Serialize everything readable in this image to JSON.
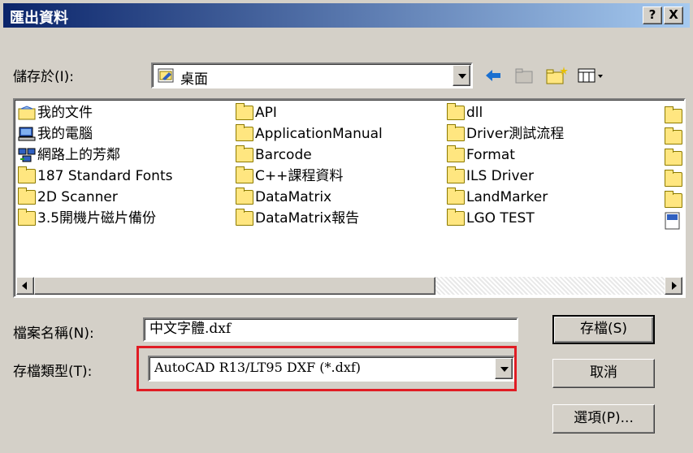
{
  "title": "匯出資料",
  "title_buttons": {
    "help": "?",
    "close": "X"
  },
  "save_in": {
    "label": "儲存於",
    "accel": "(I):",
    "value": "桌面"
  },
  "icons": [
    "back-arrow-icon",
    "up-folder-icon",
    "new-folder-icon",
    "view-menu-icon"
  ],
  "files": {
    "col1": [
      "我的文件",
      "我的電腦",
      "網路上的芳鄰",
      "187 Standard  Fonts",
      "2D Scanner",
      "3.5開機片磁片備份"
    ],
    "col2": [
      "API",
      "ApplicationManual",
      "Barcode",
      "C++課程資料",
      "DataMatrix",
      "DataMatrix報告"
    ],
    "col3": [
      "dll",
      "Driver測試流程",
      "Format",
      "ILS Driver",
      "LandMarker",
      "LGO TEST"
    ]
  },
  "filename": {
    "label": "檔案名稱",
    "accel": "(N):",
    "value": "中文字體.dxf"
  },
  "filetype": {
    "label": "存檔類型",
    "accel": "(T):",
    "value": "AutoCAD R13/LT95 DXF (*.dxf)"
  },
  "buttons": {
    "save": "存檔(S)",
    "cancel": "取消",
    "options": "選項(P)..."
  },
  "colors": {
    "titlebar": "#0a246a",
    "highlight": "#e01c24",
    "face": "#d4d0c8"
  }
}
